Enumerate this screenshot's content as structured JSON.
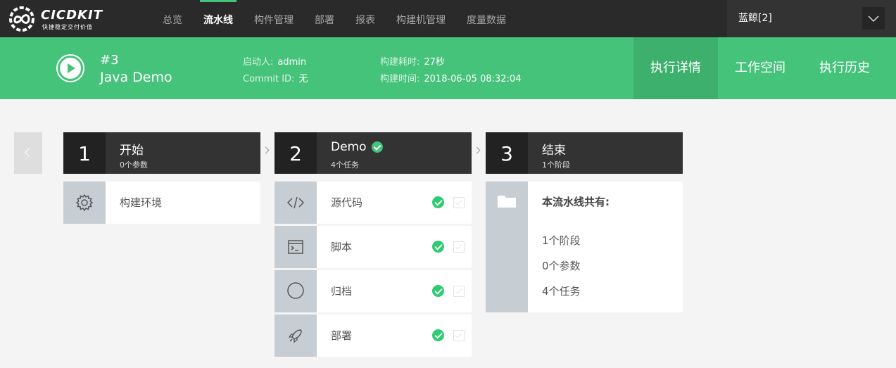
{
  "app": {
    "logo_text": "CICDKIT",
    "logo_sub": "快捷稳定交付价值"
  },
  "nav": {
    "items": [
      {
        "label": "总览"
      },
      {
        "label": "流水线",
        "active": true
      },
      {
        "label": "构件管理"
      },
      {
        "label": "部署"
      },
      {
        "label": "报表"
      },
      {
        "label": "构建机管理"
      },
      {
        "label": "度量数据"
      }
    ],
    "user": "蓝鲸[2]"
  },
  "run": {
    "number": "#3",
    "name": "Java Demo",
    "starter_label": "启动人:",
    "starter": "admin",
    "commit_label": "Commit ID:",
    "commit": "无",
    "duration_label": "构建耗时:",
    "duration": "27秒",
    "time_label": "构建时间:",
    "time": "2018-06-05 08:32:04"
  },
  "run_tabs": [
    {
      "label": "执行详情",
      "active": true
    },
    {
      "label": "工作空间"
    },
    {
      "label": "执行历史"
    }
  ],
  "stages": [
    {
      "num": "1",
      "title": "开始",
      "sub": "0个参数",
      "tasks": [
        {
          "label": "构建环境",
          "icon": "gear-icon"
        }
      ]
    },
    {
      "num": "2",
      "title": "Demo",
      "sub": "4个任务",
      "status": "success",
      "tasks": [
        {
          "label": "源代码",
          "icon": "code-icon",
          "status": "success"
        },
        {
          "label": "脚本",
          "icon": "terminal-icon",
          "status": "success"
        },
        {
          "label": "归档",
          "icon": "circle-icon",
          "status": "success"
        },
        {
          "label": "部署",
          "icon": "rocket-icon",
          "status": "success"
        }
      ]
    },
    {
      "num": "3",
      "title": "结束",
      "sub": "1个阶段",
      "summary": {
        "icon": "folder-icon",
        "title": "本流水线共有:",
        "lines": [
          "1个阶段",
          "0个参数",
          "4个任务"
        ]
      }
    }
  ],
  "colors": {
    "nav_bg": "#2a2a2a",
    "accent_green": "#46c37b",
    "stage_header": "#333333",
    "task_icon_bg": "#c6ced4",
    "success": "#2ecc71"
  }
}
